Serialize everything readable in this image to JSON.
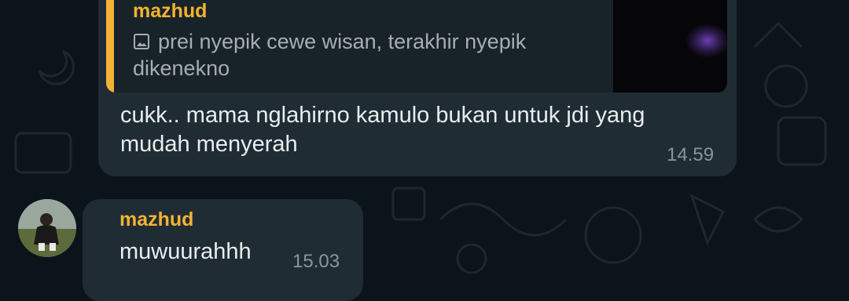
{
  "quoted_message": {
    "sender": "mazhud",
    "text": "prei nyepik cewe wisan, terakhir nyepik dikenekno",
    "attachment_icon": "image-icon"
  },
  "messages": [
    {
      "text": "cukk.. mama nglahirno kamulo bukan untuk jdi yang mudah menyerah",
      "time": "14.59"
    },
    {
      "sender": "mazhud",
      "text": "muwuurahhh",
      "time": "15.03"
    }
  ],
  "colors": {
    "background": "#0b141a",
    "bubble": "#1f2c34",
    "quote_background": "#182229",
    "sender_name": "#f2b233",
    "message_text": "#e9edef",
    "timestamp": "#8696a0"
  }
}
